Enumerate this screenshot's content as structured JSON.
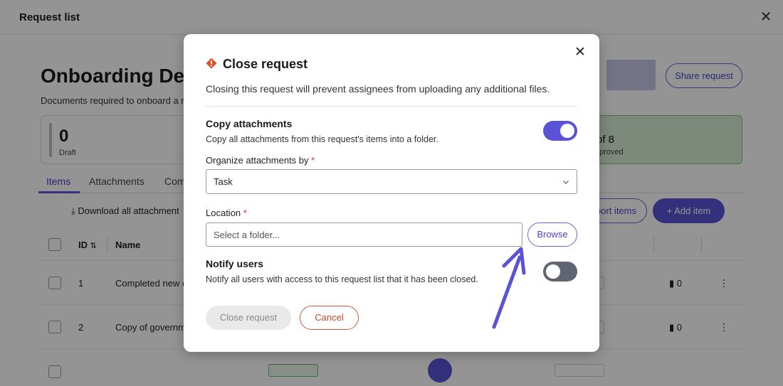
{
  "background": {
    "topbar": {
      "title": "Request list"
    },
    "page": {
      "title": "Onboarding Det",
      "description": "Documents required to onboard a ne",
      "share_label": "Share request"
    },
    "stats": {
      "draft": {
        "value": "0",
        "label": "Draft"
      },
      "approved": {
        "value": "of 8",
        "label": "pproved"
      }
    },
    "tabs": [
      {
        "label": "Items"
      },
      {
        "label": "Attachments"
      },
      {
        "label": "Com"
      }
    ],
    "toolbar": {
      "download_label": "Download all attachment",
      "export_label": "port items",
      "add_label": "+ Add item"
    },
    "table": {
      "headers": {
        "id": "ID",
        "name": "Name"
      },
      "rows": [
        {
          "id": "1",
          "name": "Completed new c",
          "attachments": "0"
        },
        {
          "id": "2",
          "name": "Copy of governm",
          "attachments": "0"
        }
      ]
    }
  },
  "modal": {
    "title": "Close request",
    "description": "Closing this request will prevent assignees from uploading any additional files.",
    "copy_attachments": {
      "title": "Copy attachments",
      "description": "Copy all attachments from this request's items into a folder.",
      "enabled": true
    },
    "organize": {
      "label": "Organize attachments by",
      "required_mark": "*",
      "selected": "Task"
    },
    "location": {
      "label": "Location",
      "required_mark": "*",
      "placeholder": "Select a folder...",
      "browse_label": "Browse"
    },
    "notify": {
      "title": "Notify users",
      "description": "Notify all users with access to this request list that it has been closed.",
      "enabled": false
    },
    "actions": {
      "close_label": "Close request",
      "cancel_label": "Cancel"
    }
  },
  "colors": {
    "accent": "#5b53d6",
    "warning": "#d9532c",
    "cancel": "#d0593a",
    "required": "#d2322d",
    "annotation_arrow": "#5b53d6"
  }
}
